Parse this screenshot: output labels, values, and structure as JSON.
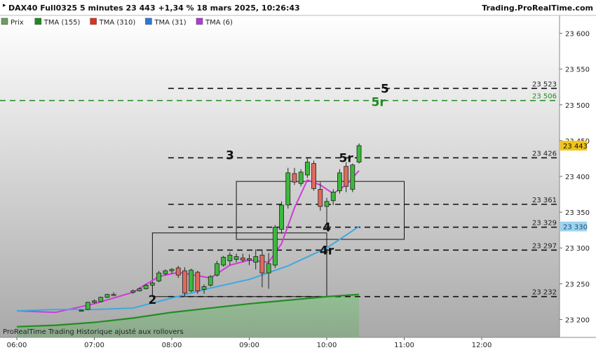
{
  "header": {
    "title": "DAX40 Full0325 5 minutes 23 443 +1,34 % 18 mars 2025, 10:26:43",
    "brand": "Trading.ProRealTime.com"
  },
  "legend": [
    {
      "label": "Prix",
      "color": "#6a9f5e"
    },
    {
      "label": "TMA (155)",
      "color": "#1f8a1f"
    },
    {
      "label": "TMA (310)",
      "color": "#e0301e"
    },
    {
      "label": "TMA (31)",
      "color": "#2f78d8"
    },
    {
      "label": "TMA (6)",
      "color": "#b03ad8"
    }
  ],
  "footer_note": "ProRealTime Trading  Historique ajusté aux rollovers",
  "colors": {
    "up": "#3db83d",
    "down": "#e06a5c",
    "tma155": "#238c23",
    "tma31": "#40a8e0",
    "tma6": "#d23ad8",
    "dashed_green": "#1e8a1e",
    "last_price_bg": "#f0c419",
    "tma31_label_bg": "#9ed3f0"
  },
  "chart_data": {
    "type": "candlestick",
    "timeframe": "5 minutes",
    "x_ticks": [
      "06:00",
      "07:00",
      "08:00",
      "09:00",
      "10:00",
      "11:00",
      "12:00"
    ],
    "y_ticks": [
      "23 600",
      "23 550",
      "23 500",
      "23 450",
      "23 400",
      "23 350",
      "23 300",
      "23 250",
      "23 200"
    ],
    "y_tick_values": [
      23600,
      23550,
      23500,
      23450,
      23400,
      23350,
      23300,
      23250,
      23200
    ],
    "ylim": [
      23175,
      23625
    ],
    "x_start": "06:00",
    "candles": [
      [
        "06:50",
        23213,
        23214,
        23212,
        23213
      ],
      [
        "06:55",
        23214,
        23225,
        23213,
        23224
      ],
      [
        "07:00",
        23224,
        23228,
        23222,
        23226
      ],
      [
        "07:05",
        23225,
        23232,
        23224,
        23231
      ],
      [
        "07:10",
        23231,
        23236,
        23230,
        23235
      ],
      [
        "07:15",
        23235,
        23238,
        23233,
        23234
      ],
      [
        "07:30",
        23238,
        23242,
        23236,
        23240
      ],
      [
        "07:35",
        23240,
        23245,
        23239,
        23243
      ],
      [
        "07:40",
        23243,
        23250,
        23242,
        23248
      ],
      [
        "07:45",
        23248,
        23253,
        23246,
        23251
      ],
      [
        "07:50",
        23254,
        23268,
        23252,
        23265
      ],
      [
        "07:55",
        23264,
        23270,
        23262,
        23268
      ],
      [
        "08:00",
        23268,
        23272,
        23264,
        23270
      ],
      [
        "08:05",
        23272,
        23275,
        23258,
        23262
      ],
      [
        "08:10",
        23268,
        23273,
        23232,
        23237
      ],
      [
        "08:15",
        23240,
        23271,
        23238,
        23269
      ],
      [
        "08:20",
        23266,
        23268,
        23236,
        23240
      ],
      [
        "08:25",
        23242,
        23249,
        23236,
        23246
      ],
      [
        "08:30",
        23248,
        23262,
        23246,
        23260
      ],
      [
        "08:35",
        23262,
        23282,
        23260,
        23278
      ],
      [
        "08:40",
        23276,
        23289,
        23274,
        23287
      ],
      [
        "08:45",
        23282,
        23294,
        23276,
        23290
      ],
      [
        "08:50",
        23284,
        23292,
        23280,
        23288
      ],
      [
        "08:55",
        23286,
        23292,
        23280,
        23283
      ],
      [
        "09:00",
        23283,
        23291,
        23276,
        23285
      ],
      [
        "09:05",
        23280,
        23298,
        23270,
        23288
      ],
      [
        "09:10",
        23290,
        23298,
        23245,
        23265
      ],
      [
        "09:15",
        23265,
        23293,
        23243,
        23278
      ],
      [
        "09:20",
        23276,
        23332,
        23272,
        23329
      ],
      [
        "09:25",
        23326,
        23365,
        23320,
        23360
      ],
      [
        "09:30",
        23360,
        23412,
        23355,
        23405
      ],
      [
        "09:35",
        23404,
        23412,
        23388,
        23392
      ],
      [
        "09:40",
        23390,
        23410,
        23386,
        23406
      ],
      [
        "09:45",
        23402,
        23426,
        23398,
        23420
      ],
      [
        "09:50",
        23418,
        23422,
        23380,
        23383
      ],
      [
        "09:55",
        23382,
        23392,
        23352,
        23358
      ],
      [
        "10:00",
        23358,
        23370,
        23335,
        23365
      ],
      [
        "10:05",
        23366,
        23382,
        23360,
        23378
      ],
      [
        "10:10",
        23380,
        23410,
        23376,
        23405
      ],
      [
        "10:15",
        23414,
        23420,
        23378,
        23386
      ],
      [
        "10:20",
        23382,
        23418,
        23378,
        23416
      ],
      [
        "10:25",
        23420,
        23446,
        23418,
        23443
      ]
    ],
    "moving_averages": [
      {
        "name": "TMA (6)",
        "color": "#d23ad8",
        "points": [
          [
            "06:00",
            23212
          ],
          [
            "06:30",
            23210
          ],
          [
            "07:00",
            23222
          ],
          [
            "07:30",
            23238
          ],
          [
            "07:50",
            23260
          ],
          [
            "08:05",
            23266
          ],
          [
            "08:30",
            23258
          ],
          [
            "08:45",
            23276
          ],
          [
            "09:00",
            23283
          ],
          [
            "09:15",
            23280
          ],
          [
            "09:25",
            23306
          ],
          [
            "09:35",
            23356
          ],
          [
            "09:45",
            23395
          ],
          [
            "09:55",
            23388
          ],
          [
            "10:05",
            23376
          ],
          [
            "10:15",
            23388
          ],
          [
            "10:25",
            23408
          ]
        ]
      },
      {
        "name": "TMA (31)",
        "color": "#40a8e0",
        "points": [
          [
            "06:00",
            23212
          ],
          [
            "06:30",
            23214
          ],
          [
            "07:00",
            23214
          ],
          [
            "07:30",
            23216
          ],
          [
            "08:00",
            23230
          ],
          [
            "08:30",
            23244
          ],
          [
            "09:00",
            23256
          ],
          [
            "09:30",
            23275
          ],
          [
            "10:00",
            23300
          ],
          [
            "10:25",
            23330
          ]
        ]
      },
      {
        "name": "TMA (155)",
        "color": "#238c23",
        "points": [
          [
            "06:00",
            23190
          ],
          [
            "06:30",
            23192
          ],
          [
            "07:00",
            23196
          ],
          [
            "07:30",
            23202
          ],
          [
            "08:00",
            23210
          ],
          [
            "08:30",
            23216
          ],
          [
            "09:00",
            23222
          ],
          [
            "09:30",
            23227
          ],
          [
            "10:00",
            23232
          ],
          [
            "10:25",
            23235
          ]
        ]
      }
    ],
    "horizontal_lines": [
      {
        "value": 23523,
        "label": "23 523",
        "style": "black-dashed"
      },
      {
        "value": 23506,
        "label": "23 506",
        "style": "green-dashed"
      },
      {
        "value": 23426,
        "label": "23 426",
        "style": "black-dashed"
      },
      {
        "value": 23361,
        "label": "23 361",
        "style": "black-dashed"
      },
      {
        "value": 23329,
        "label": "23 329",
        "style": "black-dashed"
      },
      {
        "value": 23297,
        "label": "23 297",
        "style": "black-dashed"
      },
      {
        "value": 23232,
        "label": "23 232",
        "style": "black-dashed"
      }
    ],
    "price_boxes": [
      {
        "from": "07:45",
        "to": "10:00",
        "low": 23232,
        "high": 23321
      },
      {
        "from": "08:50",
        "to": "11:00",
        "low": 23312,
        "high": 23393
      }
    ],
    "annotations": [
      {
        "text": "2",
        "time": "07:45",
        "value": 23228
      },
      {
        "text": "3",
        "time": "08:45",
        "value": 23430
      },
      {
        "text": "4",
        "time": "10:00",
        "value": 23329
      },
      {
        "text": "4r",
        "time": "10:00",
        "value": 23297
      },
      {
        "text": "5r",
        "time": "10:15",
        "value": 23426
      },
      {
        "text": "5",
        "time": "10:45",
        "value": 23523
      },
      {
        "text": "5r",
        "time": "10:40",
        "value": 23504,
        "color": "#1e8a1e"
      }
    ],
    "last_price": {
      "value": 23443,
      "label": "23 443"
    },
    "tma31_value": {
      "value": 23330,
      "label": "23 330"
    }
  }
}
